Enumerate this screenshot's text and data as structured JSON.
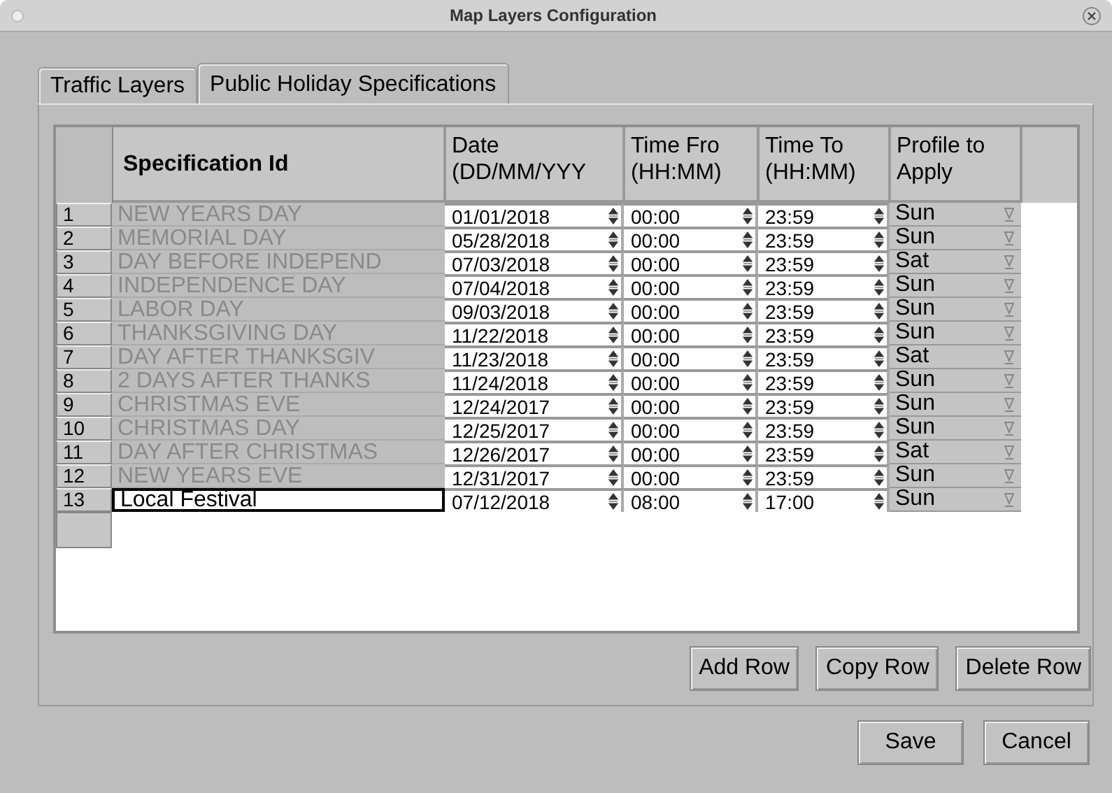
{
  "window": {
    "title": "Map Layers Configuration"
  },
  "tabs": [
    {
      "label": "Traffic Layers",
      "selected": false
    },
    {
      "label": "Public Holiday Specifications",
      "selected": true
    }
  ],
  "table": {
    "columns": [
      "Specification Id",
      "Date (DD/MM/YYY",
      "Time Fro (HH:MM)",
      "Time To (HH:MM)",
      "Profile to Apply"
    ],
    "rows": [
      {
        "number": "1",
        "spec_id": "NEW YEARS DAY",
        "disabled": true,
        "focused": false,
        "date": "01/01/2018",
        "time_from": "00:00",
        "time_to": "23:59",
        "profile": "Sun"
      },
      {
        "number": "2",
        "spec_id": "MEMORIAL DAY",
        "disabled": true,
        "focused": false,
        "date": "05/28/2018",
        "time_from": "00:00",
        "time_to": "23:59",
        "profile": "Sun"
      },
      {
        "number": "3",
        "spec_id": "DAY BEFORE INDEPEND",
        "disabled": true,
        "focused": false,
        "date": "07/03/2018",
        "time_from": "00:00",
        "time_to": "23:59",
        "profile": "Sat"
      },
      {
        "number": "4",
        "spec_id": "INDEPENDENCE DAY",
        "disabled": true,
        "focused": false,
        "date": "07/04/2018",
        "time_from": "00:00",
        "time_to": "23:59",
        "profile": "Sun"
      },
      {
        "number": "5",
        "spec_id": "LABOR DAY",
        "disabled": true,
        "focused": false,
        "date": "09/03/2018",
        "time_from": "00:00",
        "time_to": "23:59",
        "profile": "Sun"
      },
      {
        "number": "6",
        "spec_id": "THANKSGIVING DAY",
        "disabled": true,
        "focused": false,
        "date": "11/22/2018",
        "time_from": "00:00",
        "time_to": "23:59",
        "profile": "Sun"
      },
      {
        "number": "7",
        "spec_id": "DAY AFTER THANKSGIV",
        "disabled": true,
        "focused": false,
        "date": "11/23/2018",
        "time_from": "00:00",
        "time_to": "23:59",
        "profile": "Sat"
      },
      {
        "number": "8",
        "spec_id": "2 DAYS AFTER THANKS",
        "disabled": true,
        "focused": false,
        "date": "11/24/2018",
        "time_from": "00:00",
        "time_to": "23:59",
        "profile": "Sun"
      },
      {
        "number": "9",
        "spec_id": "CHRISTMAS EVE",
        "disabled": true,
        "focused": false,
        "date": "12/24/2017",
        "time_from": "00:00",
        "time_to": "23:59",
        "profile": "Sun"
      },
      {
        "number": "10",
        "spec_id": "CHRISTMAS DAY",
        "disabled": true,
        "focused": false,
        "date": "12/25/2017",
        "time_from": "00:00",
        "time_to": "23:59",
        "profile": "Sun"
      },
      {
        "number": "11",
        "spec_id": "DAY AFTER CHRISTMAS",
        "disabled": true,
        "focused": false,
        "date": "12/26/2017",
        "time_from": "00:00",
        "time_to": "23:59",
        "profile": "Sat"
      },
      {
        "number": "12",
        "spec_id": "NEW YEARS EVE",
        "disabled": true,
        "focused": false,
        "date": "12/31/2017",
        "time_from": "00:00",
        "time_to": "23:59",
        "profile": "Sun"
      },
      {
        "number": "13",
        "spec_id": "Local Festival",
        "disabled": false,
        "focused": true,
        "date": "07/12/2018",
        "time_from": "08:00",
        "time_to": "17:00",
        "profile": "Sun"
      }
    ]
  },
  "row_buttons": [
    "Add Row",
    "Copy Row",
    "Delete Row"
  ],
  "dialog_buttons": [
    "Save",
    "Cancel"
  ]
}
